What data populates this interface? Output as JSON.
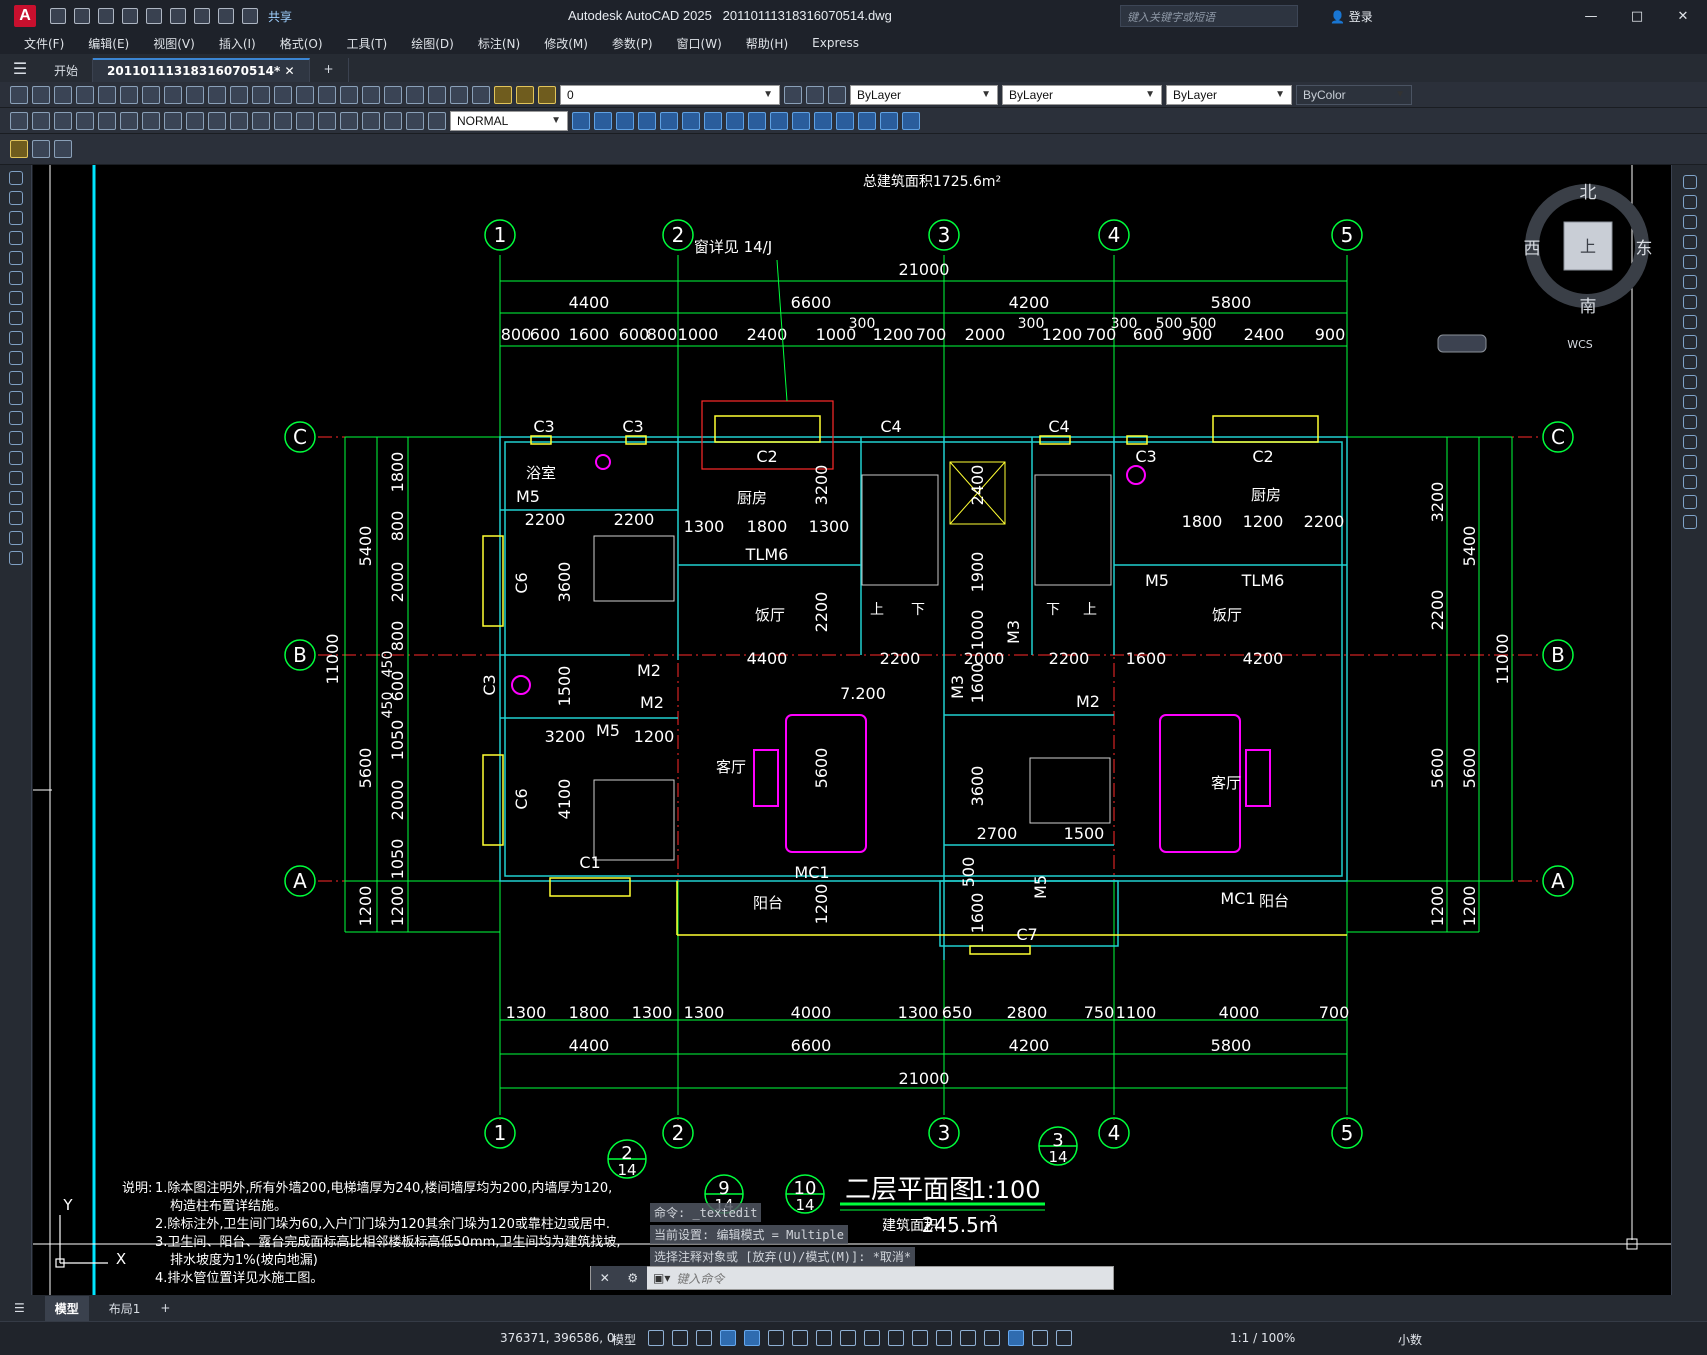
{
  "app": {
    "title": "Autodesk AutoCAD 2025",
    "filename": "20110111318316070514.dwg",
    "search_placeholder": "键入关键字或短语",
    "login": "登录",
    "share": "共享",
    "logo_letter": "A"
  },
  "menu": [
    "文件(F)",
    "编辑(E)",
    "视图(V)",
    "插入(I)",
    "格式(O)",
    "工具(T)",
    "绘图(D)",
    "标注(N)",
    "修改(M)",
    "参数(P)",
    "窗口(W)",
    "帮助(H)",
    "Express"
  ],
  "tabs": {
    "start": "开始",
    "active": "20110111318316070514*",
    "add": "+"
  },
  "toolbar": {
    "layer_name": "0",
    "color": "ByLayer",
    "linetype": "ByLayer",
    "lineweight": "ByLayer",
    "plotstyle": "ByColor",
    "text_style": "NORMAL"
  },
  "drawing": {
    "total_area": "总建筑面积1725.6m²",
    "title": "二层平面图",
    "scale": "1:100",
    "area_label": "建筑面积",
    "area_value": "245.5m",
    "area_unit": "2",
    "window_note": "窗详见 14/J",
    "grid_top": [
      "1",
      "2",
      "3",
      "4",
      "5"
    ],
    "grid_side": [
      "C",
      "B",
      "A"
    ],
    "dims_top_total": "21000",
    "dims_top_mid": [
      "4400",
      "6600",
      "4200",
      "5800"
    ],
    "dims_top_detail": [
      "800",
      "600",
      "1600",
      "600",
      "800",
      "1000",
      "2400",
      "1000",
      "300",
      "1200",
      "700",
      "2000",
      "300",
      "1200",
      "700",
      "600",
      "500",
      "900",
      "2400",
      "900"
    ],
    "dims_top_extra": [
      "300",
      "500"
    ],
    "dims_bottom_detail": [
      "1300",
      "1800",
      "1300",
      "1300",
      "4000",
      "1300",
      "650",
      "2800",
      "750",
      "1100",
      "4000",
      "700"
    ],
    "dims_bottom_mid": [
      "4400",
      "6600",
      "4200",
      "5800"
    ],
    "dims_bottom_total": "21000",
    "dims_left_total": "11000",
    "dims_left_mid": [
      "5400",
      "5600",
      "1200"
    ],
    "dims_left_detail": [
      "1800",
      "800",
      "2000",
      "800",
      "450",
      "600",
      "450",
      "1050",
      "2000",
      "1050",
      "1200"
    ],
    "dims_right_total": "11000",
    "dims_right_mid": [
      "5400",
      "5600",
      "1200"
    ],
    "dims_right_detail": [
      "3200",
      "2200",
      "5600",
      "1200"
    ],
    "rooms": [
      "浴室",
      "厨房",
      "饭厅",
      "客厅",
      "阳台",
      "厨房",
      "饭厅",
      "客厅",
      "阳台"
    ],
    "windows": [
      "C3",
      "C3",
      "C2",
      "C4",
      "C4",
      "C3",
      "C2",
      "C6",
      "C3",
      "C6",
      "C1",
      "C7"
    ],
    "doors": [
      "M5",
      "M2",
      "M2",
      "M5",
      "M3",
      "M3",
      "M2",
      "M5",
      "M5",
      "TLM6",
      "TLM6",
      "MC1",
      "MC1"
    ],
    "stair_labels": [
      "上",
      "下",
      "下",
      "上"
    ],
    "inner_dims": [
      "2200",
      "2200",
      "1300",
      "1800",
      "1300",
      "3600",
      "1500",
      "3200",
      "1200",
      "4100",
      "3200",
      "2400",
      "1900",
      "1000",
      "1600",
      "4400",
      "2200",
      "2000",
      "2200",
      "1600",
      "4200",
      "7.200",
      "5600",
      "3600",
      "2700",
      "1500",
      "500",
      "1600",
      "1200",
      "1800",
      "1200",
      "2200",
      "1200",
      "1200"
    ],
    "details": [
      {
        "num": "2",
        "sheet": "14"
      },
      {
        "num": "9",
        "sheet": "14"
      },
      {
        "num": "10",
        "sheet": "14"
      },
      {
        "num": "3",
        "sheet": "14"
      }
    ],
    "notes_label": "说明:",
    "notes": [
      "1.除本图注明外,所有外墙200,电梯墙厚为240,楼间墙厚均为200,内墙厚为120,",
      "构造柱布置详结施。",
      "2.除标注外,卫生间门垛为60,入户门门垛为120其余门垛为120或靠柱边或居中.",
      "3.卫生间、阳台、露台完成面标高比相邻楼板标高低50mm,卫生间均为建筑找坡,",
      "排水坡度为1%(坡向地漏)",
      "4.排水管位置详见水施工图。"
    ]
  },
  "viewcube": {
    "north": "北",
    "south": "南",
    "east": "东",
    "west": "西",
    "top": "上",
    "wcs": "WCS"
  },
  "ucs": {
    "x": "X",
    "y": "Y"
  },
  "command": {
    "history": [
      "命令: _textedit",
      "当前设置: 编辑模式 = Multiple",
      "选择注释对象或 [放弃(U)/模式(M)]: *取消*"
    ],
    "placeholder": "键入命令"
  },
  "layouts": {
    "model": "模型",
    "layout1": "布局1",
    "add": "+"
  },
  "status": {
    "coords": "376371, 396586, 0",
    "space": "模型",
    "scale": "1:1 / 100%",
    "units": "小数"
  },
  "colors": {
    "grid_line": "#ff2a2a",
    "dim": "#00ff3c",
    "wall": "#20d0d0",
    "furniture": "#ff00ff",
    "highlight": "#ffff33",
    "text": "#ffffff"
  }
}
